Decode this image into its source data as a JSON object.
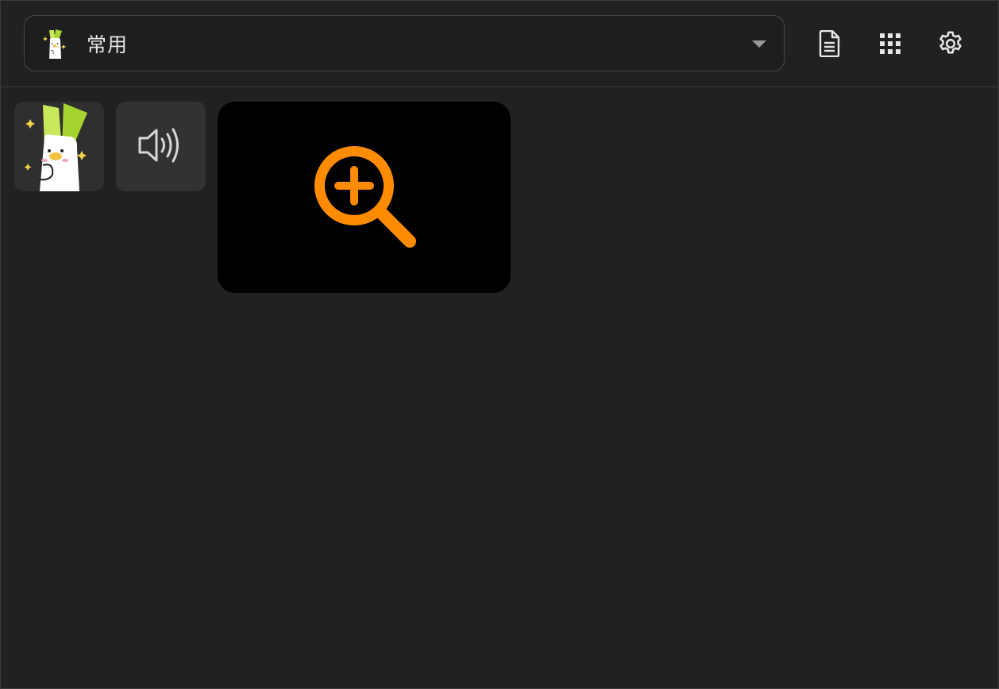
{
  "header": {
    "category": {
      "label": "常用",
      "thumbnail_icon": "leek-mascot-icon",
      "dropdown_icon": "caret-down-icon"
    },
    "actions": [
      {
        "icon": "document-icon"
      },
      {
        "icon": "grid-apps-icon"
      },
      {
        "icon": "gear-icon"
      }
    ]
  },
  "items": [
    {
      "type": "sticker",
      "icon": "leek-mascot-icon"
    },
    {
      "type": "sound",
      "icon": "speaker-icon"
    },
    {
      "type": "add",
      "icon": "zoom-plus-icon",
      "accent": "#ff8c00"
    }
  ],
  "colors": {
    "background": "#212121",
    "accent": "#ff8c00"
  }
}
